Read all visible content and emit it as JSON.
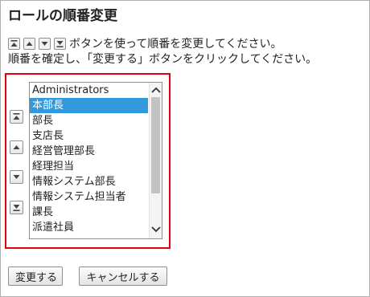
{
  "page": {
    "title": "ロールの順番変更"
  },
  "instructions": {
    "line1": "ボタンを使って順番を変更してください。",
    "line2": "順番を確定し、「変更する」ボタンをクリックしてください。",
    "inline_icons": [
      "move-top-icon",
      "move-up-icon",
      "move-down-icon",
      "move-bottom-icon"
    ]
  },
  "order_controls": [
    {
      "icon": "move-top-icon"
    },
    {
      "icon": "move-up-icon"
    },
    {
      "icon": "move-down-icon"
    },
    {
      "icon": "move-bottom-icon"
    }
  ],
  "role_list": {
    "items": [
      "Administrators",
      "本部長",
      "部長",
      "支店長",
      "経営管理部長",
      "経理担当",
      "情報システム部長",
      "情報システム担当者",
      "課長",
      "派遣社員"
    ],
    "selected": "本部長"
  },
  "buttons": {
    "submit_label": "変更する",
    "cancel_label": "キャンセルする"
  },
  "colors": {
    "highlight_border": "#e0000e",
    "selection_background": "#3399dd",
    "selection_text": "#ffffff"
  }
}
